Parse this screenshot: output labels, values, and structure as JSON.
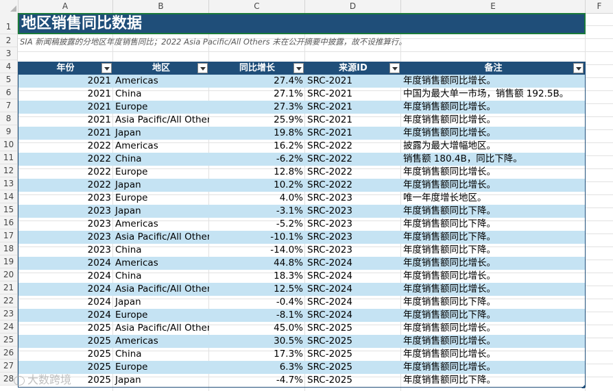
{
  "columns": [
    "A",
    "B",
    "C",
    "D",
    "E",
    "F"
  ],
  "row_numbers": [
    "1",
    "2",
    "3",
    "4",
    "5",
    "6",
    "7",
    "8",
    "9",
    "10",
    "11",
    "12",
    "13",
    "14",
    "15",
    "16",
    "17",
    "18",
    "19",
    "20",
    "21",
    "22",
    "23",
    "24",
    "25",
    "26",
    "27",
    "28"
  ],
  "title": "地区销售同比数据",
  "subtitle": "SIA 新闻稿披露的分地区年度销售同比；2022 Asia Pacific/All Others 未在公开摘要中披露，故不设推算行。",
  "headers": [
    "年份",
    "地区",
    "同比增长",
    "来源ID",
    "备注"
  ],
  "rows": [
    {
      "year": "2021",
      "region": "Americas",
      "growth": "27.4%",
      "src": "SRC-2021",
      "note": "年度销售额同比增长。"
    },
    {
      "year": "2021",
      "region": "China",
      "growth": "27.1%",
      "src": "SRC-2021",
      "note": "中国为最大单一市场，销售额 192.5B。"
    },
    {
      "year": "2021",
      "region": "Europe",
      "growth": "27.3%",
      "src": "SRC-2021",
      "note": "年度销售额同比增长。"
    },
    {
      "year": "2021",
      "region": "Asia Pacific/All Others",
      "growth": "25.9%",
      "src": "SRC-2021",
      "note": "年度销售额同比增长。"
    },
    {
      "year": "2021",
      "region": "Japan",
      "growth": "19.8%",
      "src": "SRC-2021",
      "note": "年度销售额同比增长。"
    },
    {
      "year": "2022",
      "region": "Americas",
      "growth": "16.2%",
      "src": "SRC-2022",
      "note": "披露为最大增幅地区。"
    },
    {
      "year": "2022",
      "region": "China",
      "growth": "-6.2%",
      "src": "SRC-2022",
      "note": "销售额 180.4B，同比下降。"
    },
    {
      "year": "2022",
      "region": "Europe",
      "growth": "12.8%",
      "src": "SRC-2022",
      "note": "年度销售额同比增长。"
    },
    {
      "year": "2022",
      "region": "Japan",
      "growth": "10.2%",
      "src": "SRC-2022",
      "note": "年度销售额同比增长。"
    },
    {
      "year": "2023",
      "region": "Europe",
      "growth": "4.0%",
      "src": "SRC-2023",
      "note": "唯一年度增长地区。"
    },
    {
      "year": "2023",
      "region": "Japan",
      "growth": "-3.1%",
      "src": "SRC-2023",
      "note": "年度销售额同比下降。"
    },
    {
      "year": "2023",
      "region": "Americas",
      "growth": "-5.2%",
      "src": "SRC-2023",
      "note": "年度销售额同比下降。"
    },
    {
      "year": "2023",
      "region": "Asia Pacific/All Others",
      "growth": "-10.1%",
      "src": "SRC-2023",
      "note": "年度销售额同比下降。"
    },
    {
      "year": "2023",
      "region": "China",
      "growth": "-14.0%",
      "src": "SRC-2023",
      "note": "年度销售额同比下降。"
    },
    {
      "year": "2024",
      "region": "Americas",
      "growth": "44.8%",
      "src": "SRC-2024",
      "note": "年度销售额同比增长。"
    },
    {
      "year": "2024",
      "region": "China",
      "growth": "18.3%",
      "src": "SRC-2024",
      "note": "年度销售额同比增长。"
    },
    {
      "year": "2024",
      "region": "Asia Pacific/All Others",
      "growth": "12.5%",
      "src": "SRC-2024",
      "note": "年度销售额同比增长。"
    },
    {
      "year": "2024",
      "region": "Japan",
      "growth": "-0.4%",
      "src": "SRC-2024",
      "note": "年度销售额同比下降。"
    },
    {
      "year": "2024",
      "region": "Europe",
      "growth": "-8.1%",
      "src": "SRC-2024",
      "note": "年度销售额同比下降。"
    },
    {
      "year": "2025",
      "region": "Asia Pacific/All Others",
      "growth": "45.0%",
      "src": "SRC-2025",
      "note": "年度销售额同比增长。"
    },
    {
      "year": "2025",
      "region": "Americas",
      "growth": "30.5%",
      "src": "SRC-2025",
      "note": "年度销售额同比增长。"
    },
    {
      "year": "2025",
      "region": "China",
      "growth": "17.3%",
      "src": "SRC-2025",
      "note": "年度销售额同比增长。"
    },
    {
      "year": "2025",
      "region": "Europe",
      "growth": "6.3%",
      "src": "SRC-2025",
      "note": "年度销售额同比增长。"
    },
    {
      "year": "2025",
      "region": "Japan",
      "growth": "-4.7%",
      "src": "SRC-2025",
      "note": "年度销售额同比下降。"
    }
  ],
  "watermark": "大数跨境",
  "colors": {
    "header_bg": "#1f4e79",
    "band": "#c5e3f3",
    "selection": "#1a7a3a"
  }
}
